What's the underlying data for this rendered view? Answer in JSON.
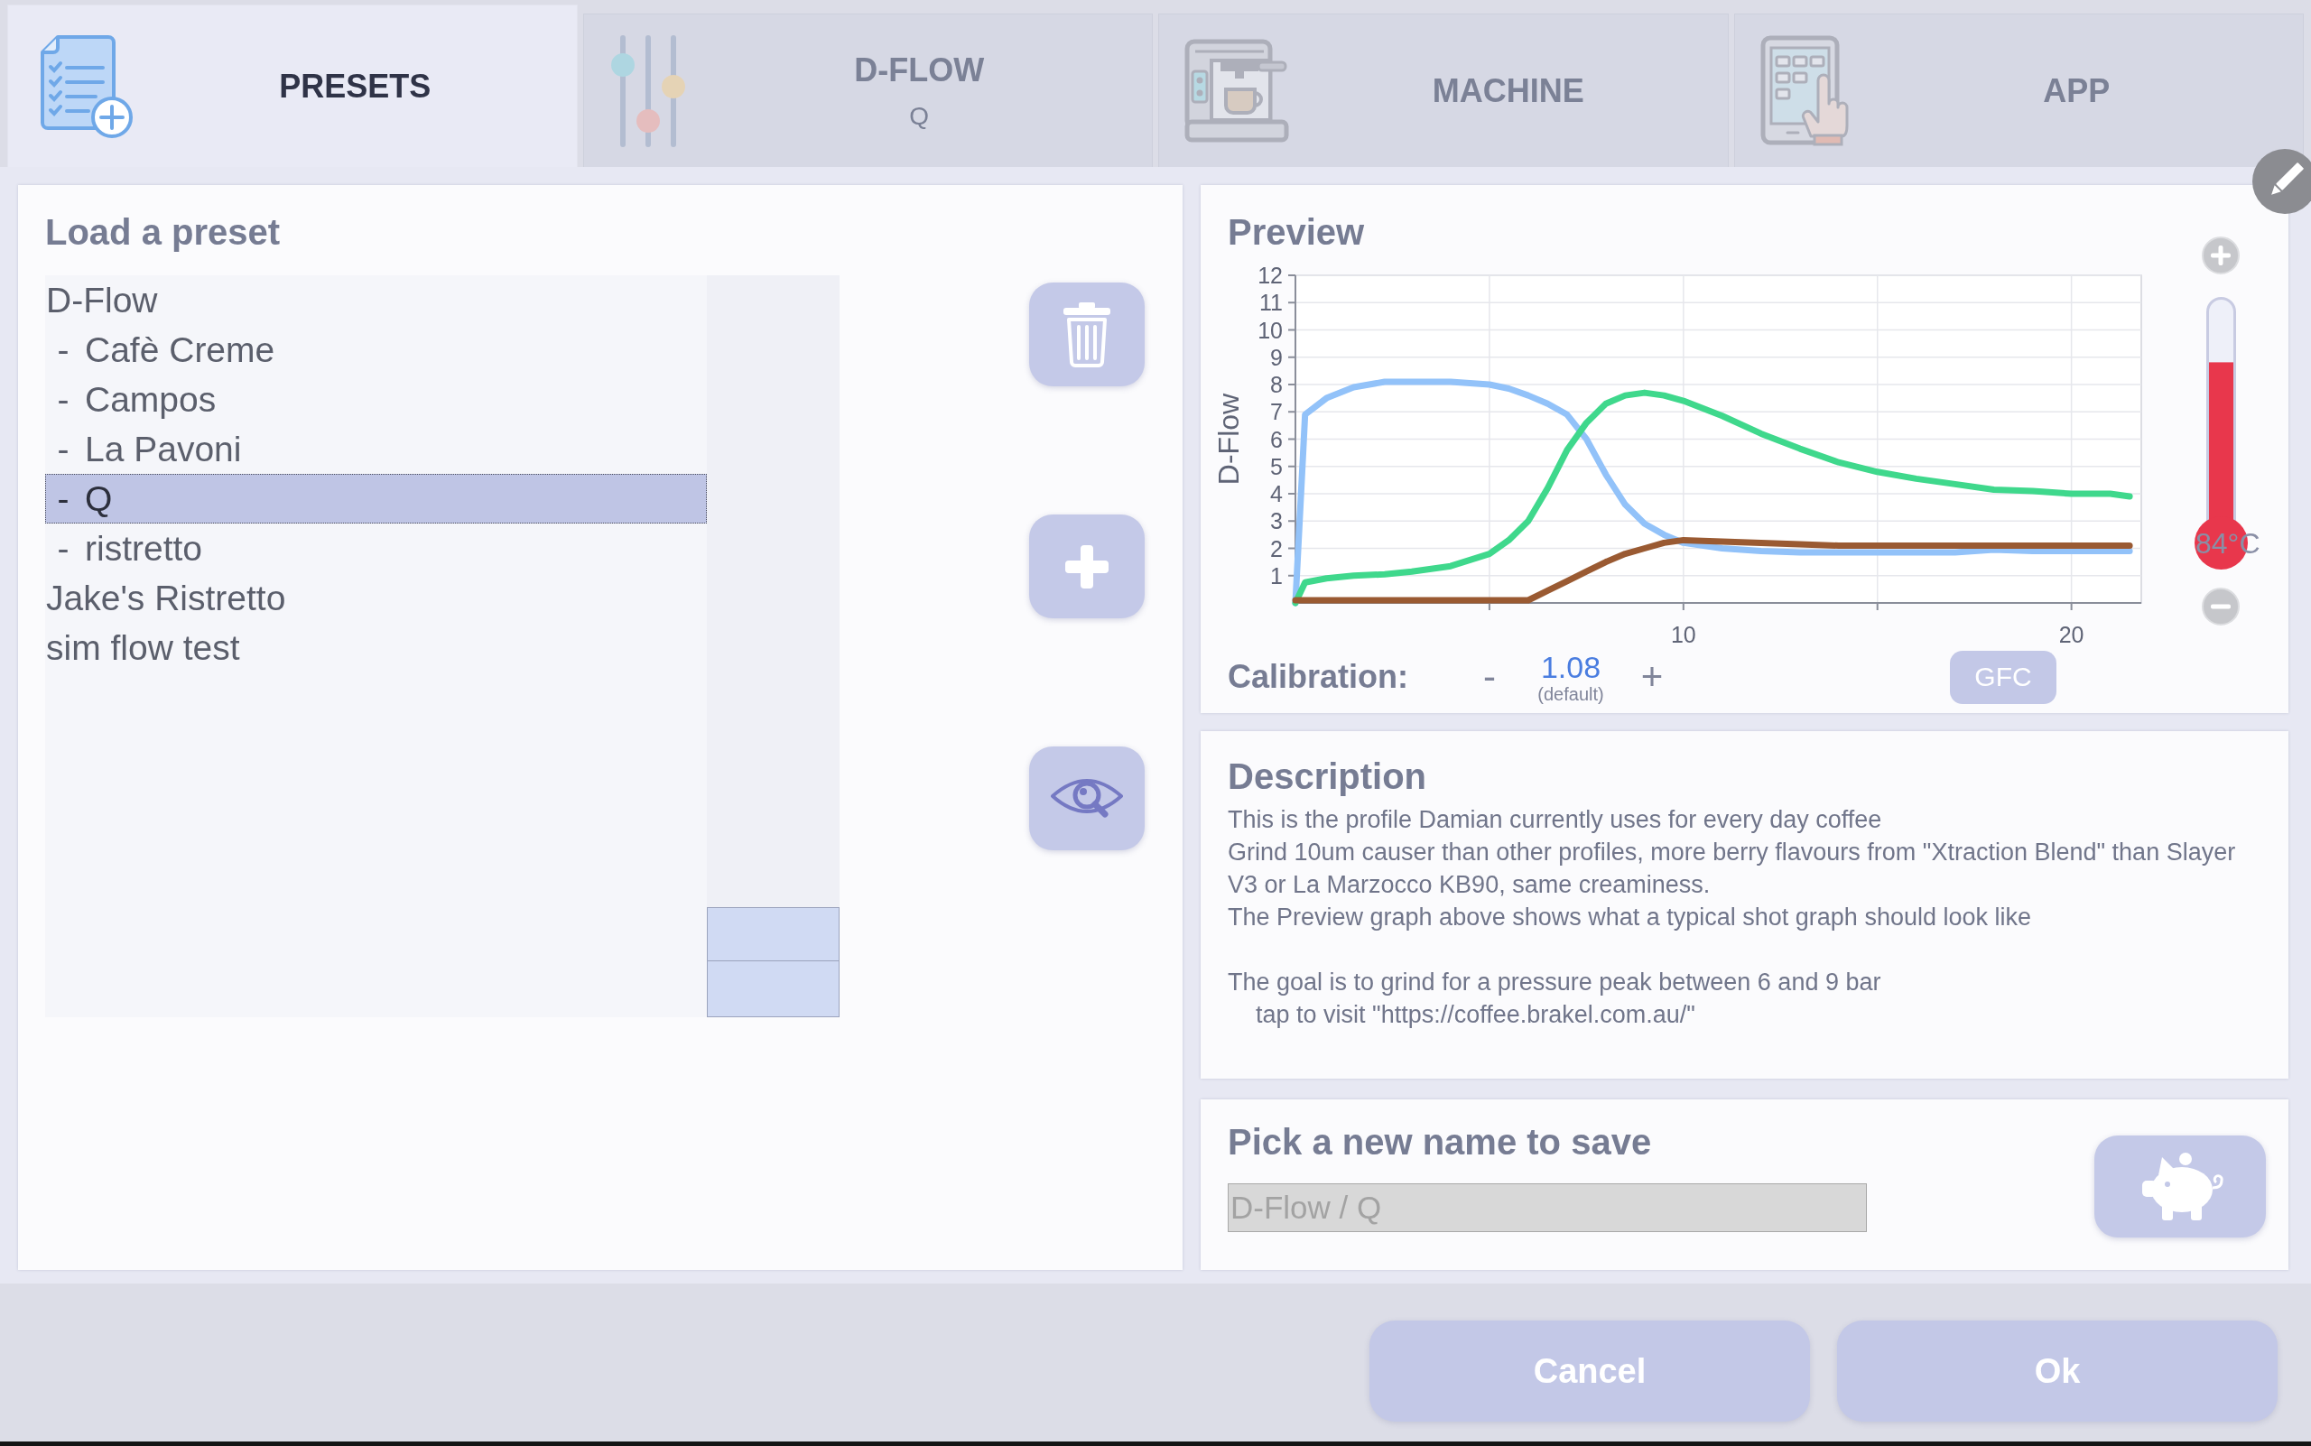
{
  "tabs": [
    {
      "kind": "presets",
      "label": "PRESETS",
      "selected": true
    },
    {
      "kind": "sliders",
      "label": "D-FLOW",
      "sublabel": "Q",
      "selected": false
    },
    {
      "kind": "machine",
      "label": "MACHINE",
      "selected": false
    },
    {
      "kind": "app",
      "label": "APP",
      "selected": false
    }
  ],
  "presets_panel": {
    "title": "Load a preset",
    "presets": [
      {
        "label": "D-Flow",
        "selected": false,
        "children": [
          {
            "bullet": "-",
            "label": "Cafè Creme",
            "selected": false
          },
          {
            "bullet": "-",
            "label": "Campos",
            "selected": false
          },
          {
            "bullet": "-",
            "label": "La Pavoni",
            "selected": false
          },
          {
            "bullet": "-",
            "label": "Q",
            "selected": true
          },
          {
            "bullet": "-",
            "label": "ristretto",
            "selected": false
          }
        ]
      },
      {
        "label": "Jake's Ristretto",
        "selected": false
      },
      {
        "label": "sim flow test",
        "selected": false
      }
    ],
    "actions": [
      {
        "kind": "delete"
      },
      {
        "kind": "add"
      },
      {
        "kind": "preview"
      }
    ]
  },
  "preview": {
    "title": "Preview",
    "chart_data": {
      "type": "line",
      "ylabel": "D-Flow",
      "x": [
        0,
        0.25,
        0.8,
        1.5,
        2.3,
        3,
        4,
        5,
        5.5,
        6,
        6.5,
        7,
        7.5,
        8,
        8.5,
        9,
        9.5,
        10,
        11,
        12,
        13,
        14,
        15,
        16,
        17,
        18,
        19,
        20,
        21,
        21.5
      ],
      "series": [
        {
          "color": "#92c2f9",
          "values": [
            0,
            6.9,
            7.5,
            7.9,
            8.1,
            8.1,
            8.1,
            8.0,
            7.85,
            7.6,
            7.3,
            6.9,
            6.0,
            4.7,
            3.6,
            2.9,
            2.5,
            2.2,
            2.0,
            1.9,
            1.85,
            1.85,
            1.85,
            1.85,
            1.85,
            1.95,
            1.9,
            1.9,
            1.9,
            1.9
          ]
        },
        {
          "color": "#3fd88c",
          "values": [
            0,
            0.75,
            0.9,
            1.0,
            1.05,
            1.15,
            1.35,
            1.8,
            2.3,
            3.0,
            4.2,
            5.6,
            6.6,
            7.3,
            7.6,
            7.7,
            7.6,
            7.4,
            6.85,
            6.2,
            5.65,
            5.15,
            4.8,
            4.55,
            4.35,
            4.15,
            4.1,
            4.0,
            4.0,
            3.9
          ]
        },
        {
          "color": "#9a5a32",
          "values": [
            0.1,
            0.1,
            0.1,
            0.1,
            0.1,
            0.1,
            0.1,
            0.1,
            0.1,
            0.1,
            0.45,
            0.8,
            1.15,
            1.5,
            1.8,
            2.0,
            2.2,
            2.3,
            2.25,
            2.2,
            2.15,
            2.1,
            2.1,
            2.1,
            2.1,
            2.1,
            2.1,
            2.1,
            2.1,
            2.1
          ]
        }
      ],
      "xlim": [
        0,
        21.8
      ],
      "ylim": [
        0,
        12
      ],
      "xticks": [
        10,
        20
      ],
      "yticks": [
        1,
        2,
        3,
        4,
        5,
        6,
        7,
        8,
        9,
        10,
        11,
        12
      ],
      "grid": true
    },
    "thermometer": {
      "level": 0.74,
      "reading": "84°C"
    },
    "calibration": {
      "label": "Calibration:",
      "decrement": "-",
      "value": "1.08",
      "note": "(default)",
      "increment": "+"
    },
    "gfc_button": "GFC"
  },
  "description": {
    "title": "Description",
    "paragraphs": [
      "This is the profile Damian currently uses for every day coffee\nGrind 10um causer than other profiles, more berry flavours from \"Xtraction Blend\" than Slayer V3 or La Marzocco KB90, same creaminess.\nThe Preview graph above shows what a typical shot graph should look like",
      "The goal is to grind for a pressure peak between 6 and 9 bar"
    ],
    "link": "tap to visit \"https://coffee.brakel.com.au/\""
  },
  "save": {
    "title": "Pick a new name to save",
    "name_field": {
      "value": "D-Flow / Q"
    }
  },
  "buttons": [
    {
      "label": "Cancel"
    },
    {
      "label": "Ok"
    }
  ]
}
